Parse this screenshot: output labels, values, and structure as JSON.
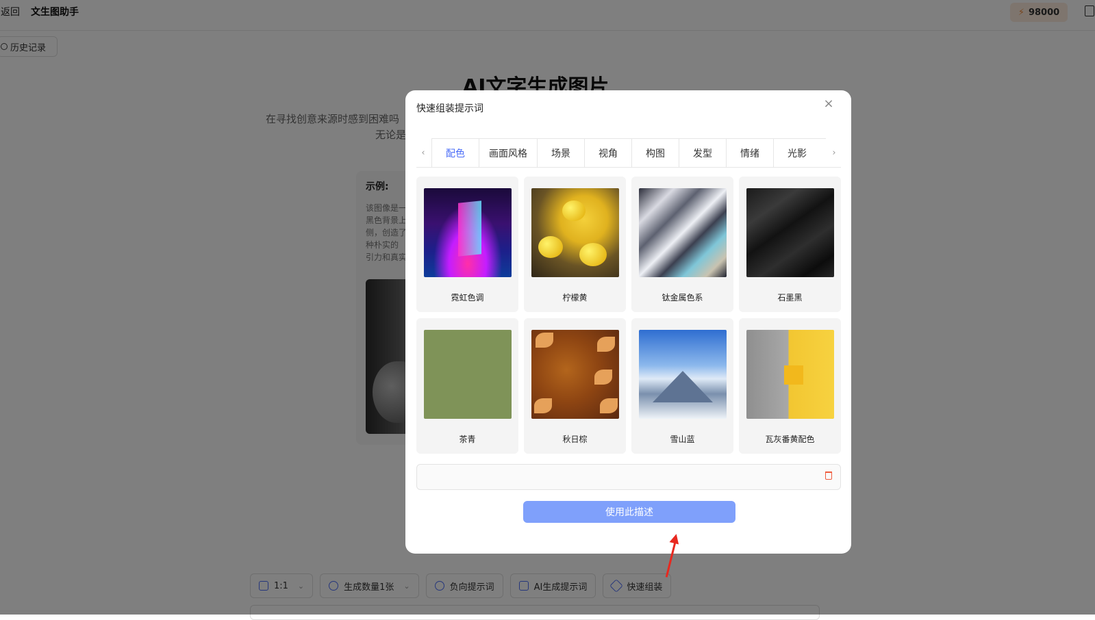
{
  "topbar": {
    "back_label": "返回",
    "app_title": "文生图助手",
    "credits": "98000"
  },
  "history_label": "历史记录",
  "hero": {
    "title": "AI文字生成图片",
    "desc_line1": "在寻找创意来源时感到困难吗",
    "desc_line2": "无论是"
  },
  "example": {
    "label": "示例:",
    "text": "该图像是一 黑色背景上 侧，创造了 种朴实的 引力和真实"
  },
  "bottom_bar": {
    "ratio": "1:1",
    "count": "生成数量1张",
    "negative": "负向提示词",
    "ai_prompt": "AI生成提示词",
    "quick": "快速组装"
  },
  "modal": {
    "title": "快速组装提示词",
    "close": "×",
    "tabs": [
      "配色",
      "画面风格",
      "场景",
      "视角",
      "构图",
      "发型",
      "情绪",
      "光影"
    ],
    "active_tab_index": 0,
    "items": [
      {
        "name": "霓虹色调",
        "thumb": "neon-glass-image"
      },
      {
        "name": "柠檬黄",
        "thumb": "lemons-still-life-image"
      },
      {
        "name": "钛金属色系",
        "thumb": "titanium-metal-image"
      },
      {
        "name": "石墨黑",
        "thumb": "graphite-black-image"
      },
      {
        "name": "茶青",
        "thumb": "tea-green-swatch"
      },
      {
        "name": "秋日棕",
        "thumb": "autumn-leaves-image"
      },
      {
        "name": "雪山蓝",
        "thumb": "snow-mountain-image"
      },
      {
        "name": "瓦灰番黄配色",
        "thumb": "gray-yellow-geometry-image"
      }
    ],
    "prompt_value": "",
    "use_button": "使用此描述"
  },
  "colors": {
    "accent": "#4a6cf7",
    "button": "#7fa0fb",
    "annotation_arrow": "#e8281f",
    "trash": "#ef5a3c"
  }
}
